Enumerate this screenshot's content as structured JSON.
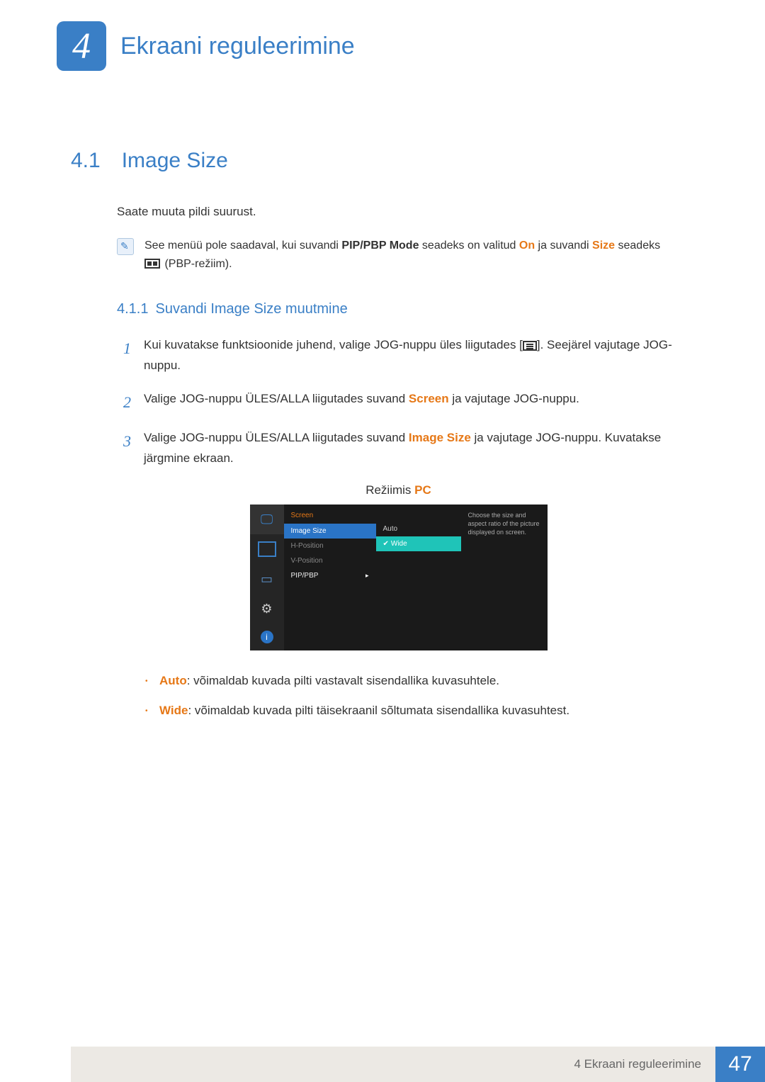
{
  "chapter": {
    "number": "4",
    "title": "Ekraani reguleerimine"
  },
  "section": {
    "number": "4.1",
    "title": "Image Size"
  },
  "intro": "Saate muuta pildi suurust.",
  "note": {
    "prefix": "See menüü pole saadaval, kui suvandi ",
    "pip_mode": "PIP/PBP Mode",
    "mid1": " seadeks on valitud ",
    "on": "On",
    "mid2": " ja suvandi ",
    "size": "Size",
    "mid3": " seadeks ",
    "suffix": " (PBP-režiim)."
  },
  "subsection": {
    "number": "4.1.1",
    "title": "Suvandi Image Size muutmine"
  },
  "steps": [
    {
      "n": "1",
      "pre": "Kui kuvatakse funktsioonide juhend, valige JOG-nuppu üles liigutades [",
      "post": "]. Seejärel vajutage JOG-nuppu."
    },
    {
      "n": "2",
      "pre": "Valige JOG-nuppu ÜLES/ALLA liigutades suvand ",
      "hl": "Screen",
      "post": " ja vajutage JOG-nuppu."
    },
    {
      "n": "3",
      "pre": "Valige JOG-nuppu ÜLES/ALLA liigutades suvand ",
      "hl": "Image Size",
      "post": " ja vajutage JOG-nuppu. Kuvatakse järgmine ekraan."
    }
  ],
  "mode_label_prefix": "Režiimis ",
  "mode_label_hl": "PC",
  "osd": {
    "header": "Screen",
    "menu": [
      "Image Size",
      "H-Position",
      "V-Position",
      "PIP/PBP"
    ],
    "options": [
      "Auto",
      "Wide"
    ],
    "help": "Choose the size and aspect ratio of the picture displayed on screen."
  },
  "bullets": [
    {
      "hl": "Auto",
      "text": ": võimaldab kuvada pilti vastavalt sisendallika kuvasuhtele."
    },
    {
      "hl": "Wide",
      "text": ": võimaldab kuvada pilti täisekraanil sõltumata sisendallika kuvasuhtest."
    }
  ],
  "footer": {
    "text": "4 Ekraani reguleerimine",
    "page": "47"
  }
}
